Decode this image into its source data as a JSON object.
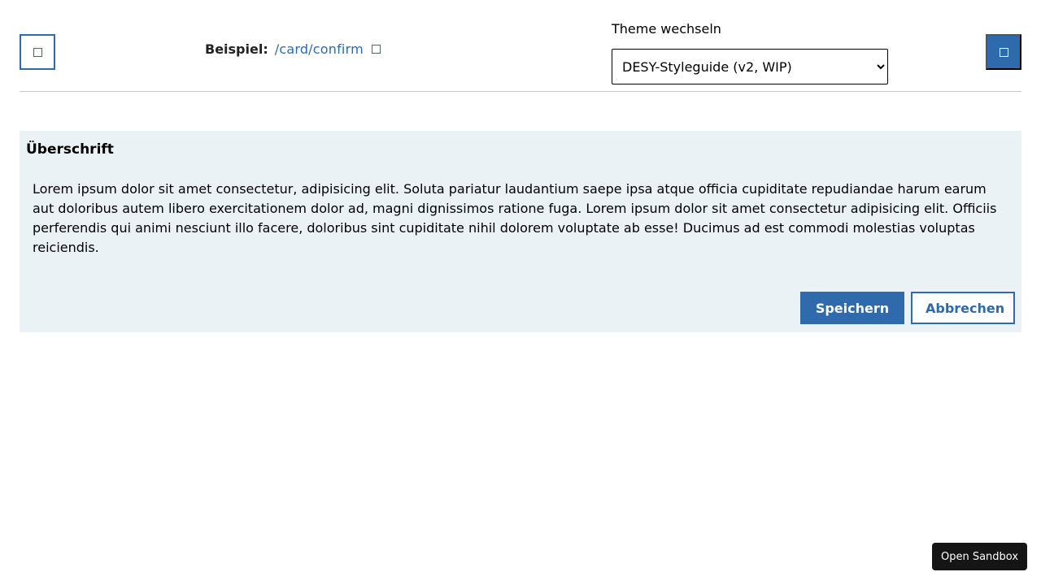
{
  "header": {
    "left_button_icon": "square-icon",
    "right_button_icon": "square-icon",
    "example_label": "Beispiel:",
    "example_path": "/card/confirm",
    "example_link_icon": "external-link-icon",
    "theme_label": "Theme wechseln",
    "theme_selected": "DESY-Styleguide (v2, WIP)"
  },
  "card": {
    "title": "Überschrift",
    "body": "Lorem ipsum dolor sit amet consectetur, adipisicing elit. Soluta pariatur laudantium saepe ipsa atque officia cupiditate repudiandae harum earum aut doloribus autem libero exercitationem dolor ad, magni dignissimos ratione fuga. Lorem ipsum dolor sit amet consectetur adipisicing elit. Officiis perferendis qui animi nesciunt illo facere, doloribus sint cupiditate nihil dolorem voluptate ab esse! Ducimus ad est commodi molestias voluptas reiciendis.",
    "save_label": "Speichern",
    "cancel_label": "Abbrechen"
  },
  "sandbox": {
    "label": "Open Sandbox"
  },
  "colors": {
    "accent": "#2f6aac",
    "card_background": "#eaf2f6",
    "sandbox_background": "#151515"
  }
}
